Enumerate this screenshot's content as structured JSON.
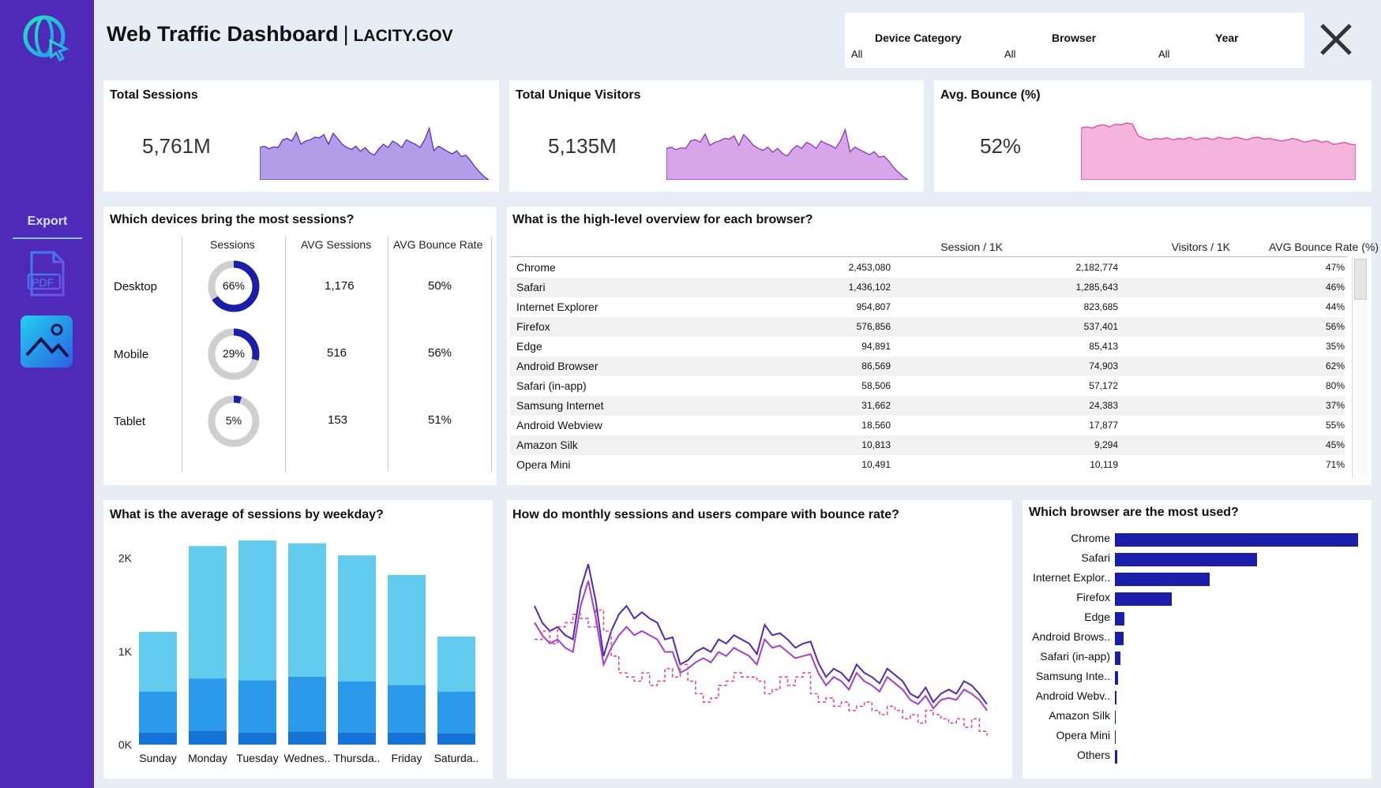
{
  "header": {
    "title": "Web Traffic Dashboard",
    "separator": "|",
    "domain": "LACITY.GOV"
  },
  "sidebar": {
    "export_label": "Export",
    "pdf_icon": "pdf-file-icon",
    "image_icon": "image-export-icon",
    "logo_icon": "globe-cursor-icon"
  },
  "filters": [
    {
      "label": "Device Category",
      "value": "All"
    },
    {
      "label": "Browser",
      "value": "All"
    },
    {
      "label": "Year",
      "value": "All"
    }
  ],
  "kpis": {
    "sessions": {
      "title": "Total Sessions",
      "value": "5,761M"
    },
    "visitors": {
      "title": "Total Unique Visitors",
      "value": "5,135M"
    },
    "bounce": {
      "title": "Avg. Bounce (%)",
      "value": "52%"
    }
  },
  "devices": {
    "title": "Which devices bring the most sessions?",
    "headers": [
      "Sessions",
      "AVG Sessions",
      "AVG Bounce Rate"
    ],
    "rows": [
      {
        "name": "Desktop",
        "share_label": "66%",
        "share": 0.66,
        "avg_sessions": "1,176",
        "bounce": "50%"
      },
      {
        "name": "Mobile",
        "share_label": "29%",
        "share": 0.29,
        "avg_sessions": "516",
        "bounce": "56%"
      },
      {
        "name": "Tablet",
        "share_label": "5%",
        "share": 0.05,
        "avg_sessions": "153",
        "bounce": "51%"
      }
    ]
  },
  "browsers": {
    "title": "What is the high-level overview for each browser?",
    "headers": [
      "Session / 1K",
      "Visitors / 1K",
      "AVG Bounce Rate (%)"
    ],
    "rows": [
      {
        "name": "Chrome",
        "session": "2,453,080",
        "visitors": "2,182,774",
        "bounce": "47%"
      },
      {
        "name": "Safari",
        "session": "1,436,102",
        "visitors": "1,285,643",
        "bounce": "46%"
      },
      {
        "name": "Internet Explorer",
        "session": "954,807",
        "visitors": "823,685",
        "bounce": "44%"
      },
      {
        "name": "Firefox",
        "session": "576,856",
        "visitors": "537,401",
        "bounce": "56%"
      },
      {
        "name": "Edge",
        "session": "94,891",
        "visitors": "85,413",
        "bounce": "35%"
      },
      {
        "name": "Android Browser",
        "session": "86,569",
        "visitors": "74,903",
        "bounce": "62%"
      },
      {
        "name": "Safari (in-app)",
        "session": "58,506",
        "visitors": "57,172",
        "bounce": "80%"
      },
      {
        "name": "Samsung Internet",
        "session": "31,662",
        "visitors": "24,383",
        "bounce": "37%"
      },
      {
        "name": "Android Webview",
        "session": "18,560",
        "visitors": "17,877",
        "bounce": "55%"
      },
      {
        "name": "Amazon Silk",
        "session": "10,813",
        "visitors": "9,294",
        "bounce": "45%"
      },
      {
        "name": "Opera Mini",
        "session": "10,491",
        "visitors": "10,119",
        "bounce": "71%"
      }
    ]
  },
  "charts_titles": {
    "weekday": "What is the average of sessions by weekday?",
    "monthly": "How do monthly sessions and users compare with bounce rate?",
    "browser_used": "Which browser are the most used?"
  },
  "colors": {
    "sidebar": "#4f2ab8",
    "accent_blue": "#1a1ea8",
    "sessions_area": "#b39ce8",
    "visitors_area": "#d7a6e8",
    "bounce_area": "#f4a9d6",
    "weekday_light": "#62ccee",
    "weekday_mid": "#2b9aea",
    "weekday_dark": "#1473d6"
  },
  "chart_data": [
    {
      "type": "bar",
      "title": "What is the average of sessions by weekday?",
      "categories": [
        "Sunday",
        "Monday",
        "Tuesday",
        "Wednes..",
        "Thursda..",
        "Friday",
        "Saturda.."
      ],
      "ytick_labels": [
        "0K",
        "1K",
        "2K"
      ],
      "ylim": [
        0,
        2200
      ],
      "stacked": true,
      "series": [
        {
          "values": [
            130,
            150,
            130,
            140,
            130,
            130,
            125
          ]
        },
        {
          "values": [
            440,
            560,
            560,
            590,
            550,
            510,
            445
          ]
        },
        {
          "values": [
            640,
            1420,
            1500,
            1430,
            1350,
            1180,
            590
          ]
        }
      ]
    },
    {
      "type": "bar",
      "title": "Which browser are the most used?",
      "categories": [
        "Chrome",
        "Safari",
        "Internet Explor..",
        "Firefox",
        "Edge",
        "Android Brows..",
        "Safari (in-app)",
        "Samsung Inte..",
        "Android Webv..",
        "Amazon Silk",
        "Opera Mini",
        "Others"
      ],
      "values": [
        2453080,
        1436102,
        954807,
        576856,
        94891,
        86569,
        58506,
        31662,
        18560,
        10813,
        10491,
        22000
      ],
      "orientation": "horizontal"
    },
    {
      "type": "line",
      "title": "How do monthly sessions and users compare with bounce rate?",
      "series": [
        {
          "values": [
            72,
            64,
            60,
            62,
            58,
            56,
            80,
            92,
            74,
            48,
            60,
            68,
            72,
            66,
            69,
            66,
            64,
            56,
            57,
            44,
            46,
            50,
            52,
            50,
            56,
            54,
            58,
            56,
            54,
            49,
            63,
            58,
            59,
            56,
            52,
            54,
            55,
            45,
            38,
            42,
            40,
            36,
            44,
            40,
            38,
            35,
            42,
            39,
            36,
            30,
            28,
            33,
            26,
            30,
            32,
            30,
            36,
            34,
            30,
            25
          ]
        },
        {
          "values": [
            64,
            58,
            54,
            56,
            52,
            50,
            72,
            84,
            66,
            44,
            52,
            58,
            62,
            58,
            60,
            58,
            56,
            50,
            50,
            40,
            42,
            45,
            47,
            45,
            50,
            48,
            52,
            50,
            48,
            44,
            56,
            52,
            53,
            50,
            47,
            48,
            49,
            40,
            34,
            38,
            36,
            32,
            40,
            36,
            34,
            31,
            38,
            35,
            32,
            27,
            25,
            29,
            23,
            27,
            28,
            27,
            32,
            30,
            27,
            22
          ]
        },
        {
          "values": [
            56,
            60,
            54,
            62,
            64,
            68,
            66,
            62,
            70,
            60,
            48,
            40,
            38,
            36,
            40,
            34,
            36,
            42,
            38,
            44,
            36,
            30,
            26,
            28,
            34,
            36,
            40,
            38,
            38,
            36,
            30,
            32,
            38,
            34,
            38,
            40,
            30,
            26,
            28,
            24,
            26,
            22,
            24,
            26,
            22,
            20,
            24,
            22,
            18,
            20,
            16,
            22,
            20,
            18,
            16,
            18,
            14,
            18,
            12,
            10
          ]
        }
      ]
    }
  ]
}
